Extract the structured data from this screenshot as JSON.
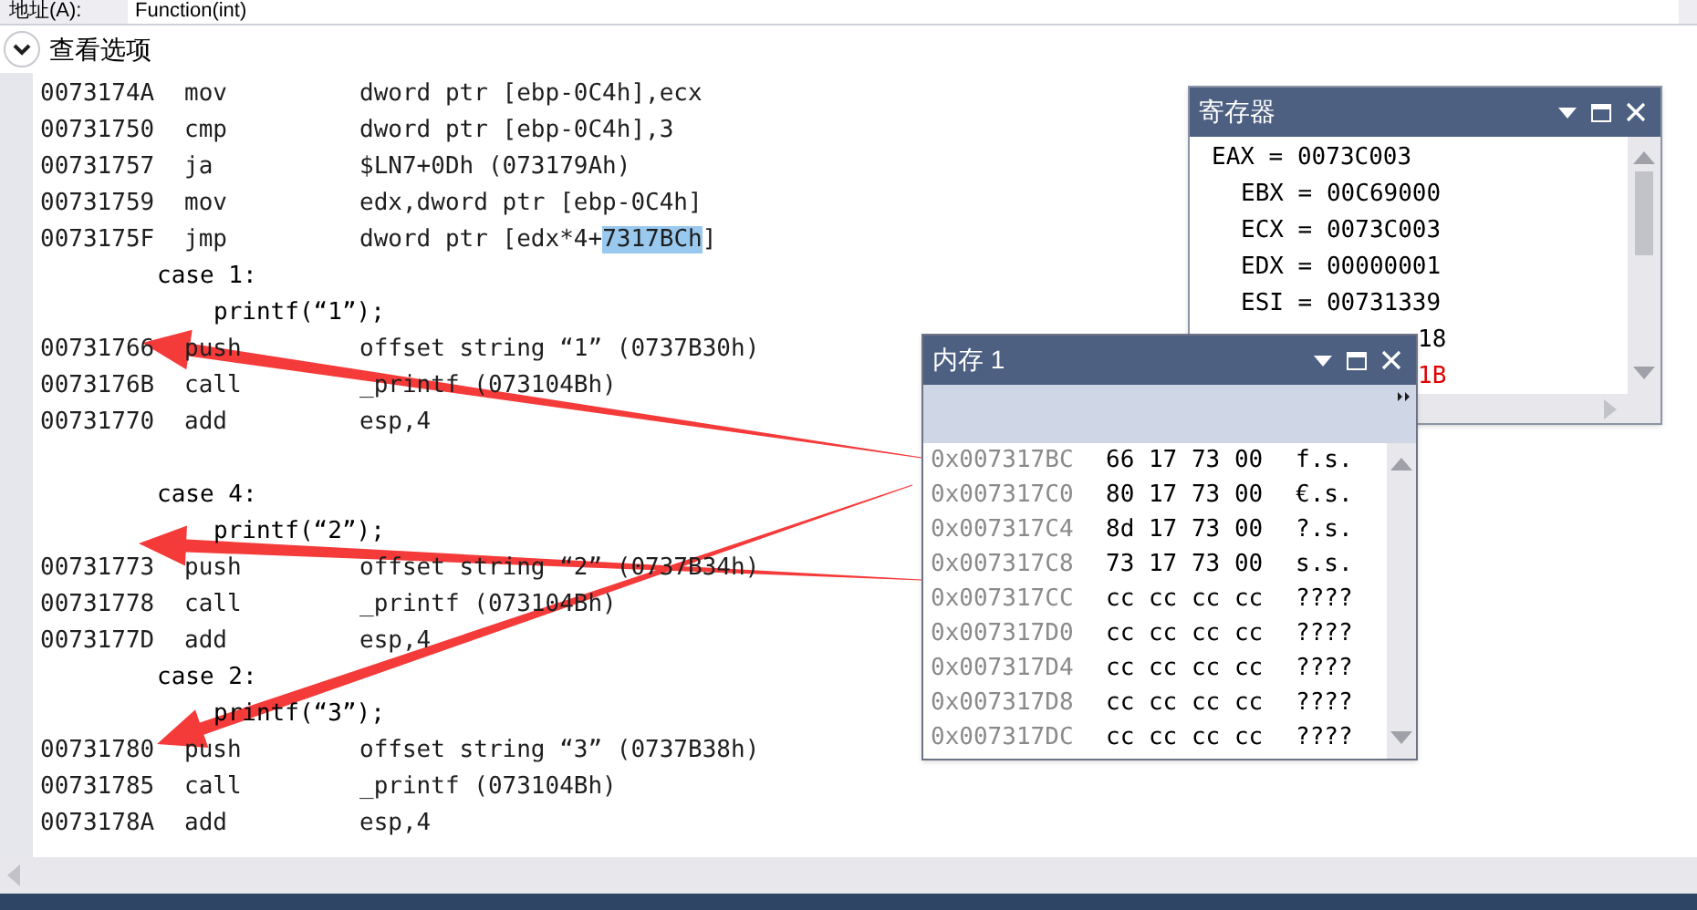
{
  "address_bar": {
    "label": "地址(A):",
    "value": "Function(int)"
  },
  "view_options": {
    "label": "查看选项",
    "expanded": true
  },
  "disassembly": [
    {
      "kind": "asm",
      "address": "0073174A",
      "mnemonic": "mov",
      "operand": "dword ptr [ebp-0C4h],ecx"
    },
    {
      "kind": "asm",
      "address": "00731750",
      "mnemonic": "cmp",
      "operand": "dword ptr [ebp-0C4h],3"
    },
    {
      "kind": "asm",
      "address": "00731757",
      "mnemonic": "ja",
      "operand": "$LN7+0Dh (073179Ah)"
    },
    {
      "kind": "asm",
      "address": "00731759",
      "mnemonic": "mov",
      "operand": "edx,dword ptr [ebp-0C4h]"
    },
    {
      "kind": "asm",
      "address": "0073175F",
      "mnemonic": "jmp",
      "operand": "dword ptr [edx*4+",
      "selection": "7317BCh",
      "operand_tail": "]"
    },
    {
      "kind": "case",
      "text": "case 1:"
    },
    {
      "kind": "stmt",
      "text": "printf(“1”);"
    },
    {
      "kind": "asm",
      "address": "00731766",
      "mnemonic": "push",
      "operand": "offset string “1” (0737B30h)"
    },
    {
      "kind": "asm",
      "address": "0073176B",
      "mnemonic": "call",
      "operand": "_printf (073104Bh)"
    },
    {
      "kind": "asm",
      "address": "00731770",
      "mnemonic": "add",
      "operand": "esp,4"
    },
    {
      "kind": "blank"
    },
    {
      "kind": "case",
      "text": "case 4:"
    },
    {
      "kind": "stmt",
      "text": "printf(“2”);"
    },
    {
      "kind": "asm",
      "address": "00731773",
      "mnemonic": "push",
      "operand": "offset string “2” (0737B34h)"
    },
    {
      "kind": "asm",
      "address": "00731778",
      "mnemonic": "call",
      "operand": "_printf (073104Bh)"
    },
    {
      "kind": "asm",
      "address": "0073177D",
      "mnemonic": "add",
      "operand": "esp,4"
    },
    {
      "kind": "case",
      "text": "case 2:"
    },
    {
      "kind": "stmt",
      "text": "printf(“3”);"
    },
    {
      "kind": "asm",
      "address": "00731780",
      "mnemonic": "push",
      "operand": "offset string “3” (0737B38h)"
    },
    {
      "kind": "asm",
      "address": "00731785",
      "mnemonic": "call",
      "operand": "_printf (073104Bh)"
    },
    {
      "kind": "asm",
      "address": "0073178A",
      "mnemonic": "add",
      "operand": "esp,4"
    }
  ],
  "registers_window": {
    "title": "寄存器",
    "rows": [
      {
        "kind": "first",
        "text": "EAX = 0073C003",
        "changed": false
      },
      {
        "kind": "reg",
        "text": "EBX = 00C69000",
        "changed": false
      },
      {
        "kind": "reg",
        "text": "ECX = 0073C003",
        "changed": false
      },
      {
        "kind": "reg",
        "text": "EDX = 00000001",
        "changed": false
      },
      {
        "kind": "reg",
        "text": "ESI = 00731339",
        "changed": false
      },
      {
        "kind": "clipped",
        "text": "18",
        "changed": false
      },
      {
        "kind": "clipped",
        "text": "1B",
        "changed": true
      }
    ]
  },
  "memory_window": {
    "title": "内存 1",
    "rows": [
      {
        "address": "0x007317BC",
        "bytes": "66 17 73 00",
        "chars": "f.s."
      },
      {
        "address": "0x007317C0",
        "bytes": "80 17 73 00",
        "chars": "€.s."
      },
      {
        "address": "0x007317C4",
        "bytes": "8d 17 73 00",
        "chars": "?.s."
      },
      {
        "address": "0x007317C8",
        "bytes": "73 17 73 00",
        "chars": "s.s."
      },
      {
        "address": "0x007317CC",
        "bytes": "cc cc cc cc",
        "chars": "????"
      },
      {
        "address": "0x007317D0",
        "bytes": "cc cc cc cc",
        "chars": "????"
      },
      {
        "address": "0x007317D4",
        "bytes": "cc cc cc cc",
        "chars": "????"
      },
      {
        "address": "0x007317D8",
        "bytes": "cc cc cc cc",
        "chars": "????"
      },
      {
        "address": "0x007317DC",
        "bytes": "cc cc cc cc",
        "chars": "????"
      }
    ]
  }
}
